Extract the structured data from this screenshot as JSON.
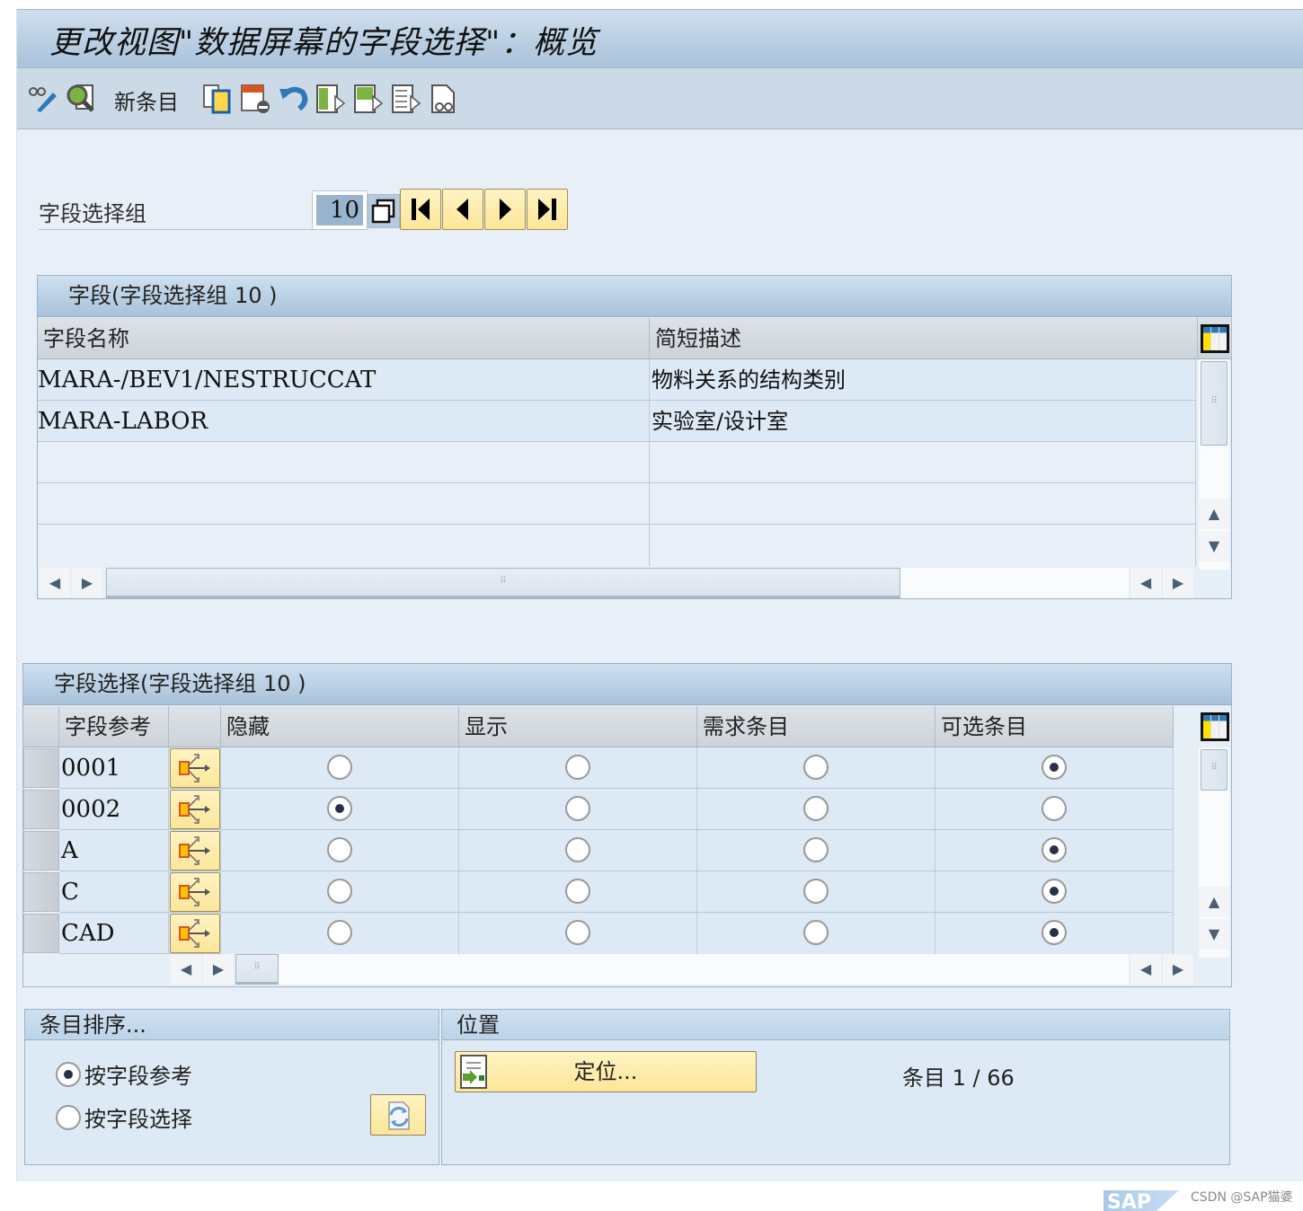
{
  "window": {
    "title": "更改视图\"数据屏幕的字段选择\"：概览"
  },
  "toolbar": {
    "icons": [
      "display-change-icon",
      "search-details-icon",
      "copy-as-icon",
      "delete-icon",
      "undo-icon",
      "select-all-icon",
      "select-block-icon",
      "deselect-all-icon",
      "print-preview-icon"
    ],
    "new_entries_label": "新条目"
  },
  "field_selection_group": {
    "label": "字段选择组",
    "value": "10",
    "nav_buttons": [
      "first-page",
      "previous-page",
      "next-page",
      "last-page"
    ]
  },
  "fields_table": {
    "title": "字段(字段选择组  10 )",
    "columns": [
      "字段名称",
      "简短描述"
    ],
    "rows": [
      {
        "field_name": "MARA-/BEV1/NESTRUCCAT",
        "description": "物料关系的结构类别"
      },
      {
        "field_name": "MARA-LABOR",
        "description": "实验室/设计室"
      },
      {
        "field_name": "",
        "description": ""
      },
      {
        "field_name": "",
        "description": ""
      },
      {
        "field_name": "",
        "description": ""
      }
    ]
  },
  "selection_table": {
    "title": "字段选择(字段选择组  10 )",
    "columns": [
      "字段参考",
      "",
      "隐藏",
      "显示",
      "需求条目",
      "可选条目"
    ],
    "rows": [
      {
        "ref": "0001",
        "selected": "可选条目"
      },
      {
        "ref": "0002",
        "selected": "隐藏"
      },
      {
        "ref": "A",
        "selected": "可选条目"
      },
      {
        "ref": "C",
        "selected": "可选条目"
      },
      {
        "ref": "CAD",
        "selected": "可选条目"
      }
    ]
  },
  "sort_panel": {
    "title": "条目排序...",
    "options": [
      {
        "label": "按字段参考",
        "checked": true
      },
      {
        "label": "按字段选择",
        "checked": false
      }
    ]
  },
  "position_panel": {
    "title": "位置",
    "button_label": "定位...",
    "entry_label": "条目",
    "entry_value": "1 / 66"
  },
  "footer": {
    "logo_text": "SAP",
    "watermark": "CSDN @SAP猫婆"
  }
}
